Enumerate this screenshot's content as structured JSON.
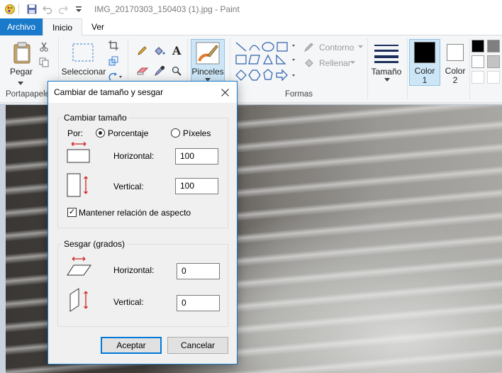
{
  "window": {
    "title": "IMG_20170303_150403 (1).jpg - Paint"
  },
  "tabs": {
    "file": "Archivo",
    "home": "Inicio",
    "view": "Ver"
  },
  "ribbon": {
    "clipboard": {
      "paste": "Pegar",
      "group": "Portapapeles"
    },
    "image": {
      "select": "Seleccionar"
    },
    "brushes": {
      "label": "Pinceles"
    },
    "shapes": {
      "outline": "Contorno",
      "fill": "Rellenar",
      "group": "Formas"
    },
    "size": {
      "label": "Tamaño"
    },
    "color1": {
      "line1": "Color",
      "line2": "1"
    },
    "color2": {
      "line1": "Color",
      "line2": "2"
    },
    "palette_colors": [
      "#000000",
      "#7f7f7f",
      "#ffffff",
      "#c3c3c3"
    ]
  },
  "dialog": {
    "title": "Cambiar de tamaño y sesgar",
    "resize": {
      "legend": "Cambiar tamaño",
      "by": "Por:",
      "percent": "Porcentaje",
      "pixels": "Píxeles",
      "horizontal_label": "Horizontal:",
      "horizontal_value": "100",
      "vertical_label": "Vertical:",
      "vertical_value": "100",
      "keep_aspect": "Mantener relación de aspecto"
    },
    "skew": {
      "legend": "Sesgar (grados)",
      "horizontal_label": "Horizontal:",
      "horizontal_value": "0",
      "vertical_label": "Vertical:",
      "vertical_value": "0"
    },
    "ok": "Aceptar",
    "cancel": "Cancelar"
  },
  "colors": {
    "accent": "#1979ca",
    "arrow": "#d32020",
    "selected_bg": "#cde6f7"
  }
}
